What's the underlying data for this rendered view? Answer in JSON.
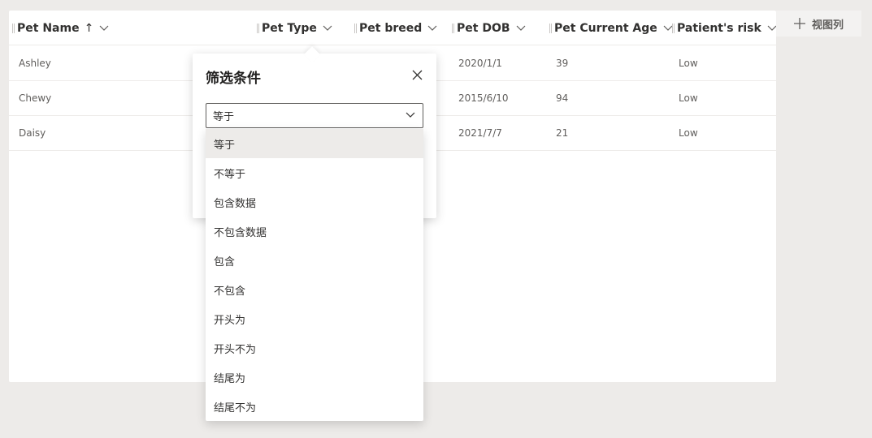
{
  "columns": [
    {
      "label": "Pet Name",
      "sort_indicator": "↑"
    },
    {
      "label": "Pet Type"
    },
    {
      "label": "Pet breed"
    },
    {
      "label": "Pet DOB"
    },
    {
      "label": "Pet Current Age"
    },
    {
      "label": "Patient's risk"
    }
  ],
  "rows": [
    {
      "name": "Ashley",
      "dob": "2020/1/1",
      "age": "39",
      "risk": "Low"
    },
    {
      "name": "Chewy",
      "dob": "2015/6/10",
      "age": "94",
      "risk": "Low"
    },
    {
      "name": "Daisy",
      "dob": "2021/7/7",
      "age": "21",
      "risk": "Low"
    }
  ],
  "view_columns_label": "视图列",
  "filter": {
    "title": "筛选条件",
    "selected_value": "等于",
    "options": [
      "等于",
      "不等于",
      "包含数据",
      "不包含数据",
      "包含",
      "不包含",
      "开头为",
      "开头不为",
      "结尾为",
      "结尾不为"
    ]
  },
  "colors": {
    "background": "#edebe9",
    "surface": "#ffffff",
    "text_primary": "#323130",
    "text_secondary": "#605e5c",
    "selected_option": "#edebe9"
  },
  "icons": [
    "chevron-down-icon",
    "add-icon",
    "close-icon"
  ]
}
